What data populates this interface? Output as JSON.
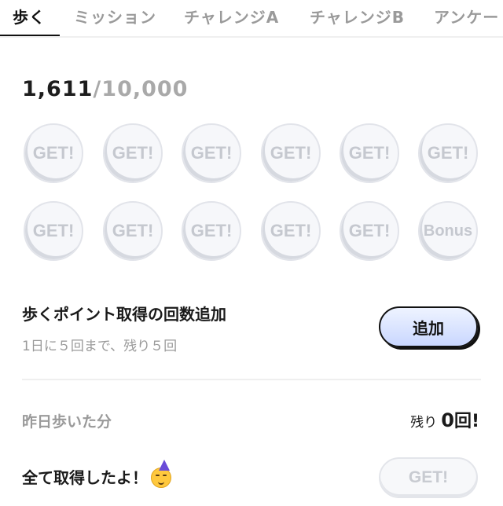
{
  "tabs": [
    {
      "label": "歩く",
      "active": true
    },
    {
      "label": "ミッション",
      "active": false
    },
    {
      "label": "チャレンジA",
      "active": false
    },
    {
      "label": "チャレンジB",
      "active": false
    },
    {
      "label": "アンケート",
      "active": false
    }
  ],
  "steps": {
    "current": "1,611",
    "separator": "/",
    "goal": "10,000"
  },
  "coins": {
    "row1": [
      "GET!",
      "GET!",
      "GET!",
      "GET!",
      "GET!",
      "GET!"
    ],
    "row2": [
      "GET!",
      "GET!",
      "GET!",
      "GET!",
      "GET!",
      "Bonus"
    ]
  },
  "add_section": {
    "title": "歩くポイント取得の回数追加",
    "subtitle": "1日に５回まで、残り５回",
    "button_label": "追加"
  },
  "yesterday": {
    "label": "昨日歩いた分",
    "remaining_prefix": "残り",
    "remaining_count": "0",
    "remaining_suffix": "回!"
  },
  "all_got": {
    "text": "全て取得したよ！",
    "emoji_icon": "partying-face-icon",
    "get_label": "GET!"
  }
}
